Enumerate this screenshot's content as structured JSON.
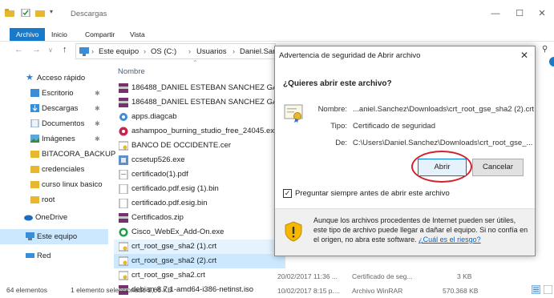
{
  "window": {
    "title": "Descargas",
    "controls": {
      "minimize": "—",
      "maximize": "☐",
      "close": "✕"
    }
  },
  "ribbon": {
    "tabs": [
      "Archivo",
      "Inicio",
      "Compartir",
      "Vista"
    ]
  },
  "address": {
    "crumbs": [
      "Este equipo",
      "OS (C:)",
      "Usuarios",
      "Daniel.Sanchez"
    ],
    "search_icon": "search-icon"
  },
  "sidebar": {
    "items": [
      {
        "label": "Acceso rápido",
        "icon": "star-icon",
        "pinned": false
      },
      {
        "label": "Escritorio",
        "icon": "desktop-icon",
        "pinned": true
      },
      {
        "label": "Descargas",
        "icon": "download-icon",
        "pinned": true
      },
      {
        "label": "Documentos",
        "icon": "document-icon",
        "pinned": true
      },
      {
        "label": "Imágenes",
        "icon": "image-icon",
        "pinned": true
      },
      {
        "label": "BITACORA_BACKUP",
        "icon": "folder-icon",
        "pinned": false
      },
      {
        "label": "credenciales",
        "icon": "folder-icon",
        "pinned": false
      },
      {
        "label": "curso linux basico",
        "icon": "folder-icon",
        "pinned": false
      },
      {
        "label": "root",
        "icon": "folder-icon",
        "pinned": false
      },
      {
        "label": "OneDrive",
        "icon": "cloud-icon",
        "pinned": false
      },
      {
        "label": "Este equipo",
        "icon": "computer-icon",
        "pinned": false
      },
      {
        "label": "Red",
        "icon": "network-icon",
        "pinned": false
      }
    ]
  },
  "list": {
    "column_name": "Nombre",
    "files": [
      {
        "name": "186488_DANIEL ESTEBAN SANCHEZ GA...",
        "icon": "archive-icon"
      },
      {
        "name": "186488_DANIEL ESTEBAN SANCHEZ GA...",
        "icon": "archive-icon"
      },
      {
        "name": "apps.diagcab",
        "icon": "diagcab-icon"
      },
      {
        "name": "ashampoo_burning_studio_free_24045.exe",
        "icon": "exe-icon"
      },
      {
        "name": "BANCO DE OCCIDENTE.cer",
        "icon": "certificate-icon"
      },
      {
        "name": "ccsetup526.exe",
        "icon": "exe-icon"
      },
      {
        "name": "certificado(1).pdf",
        "icon": "pdf-icon"
      },
      {
        "name": "certificado.pdf.esig (1).bin",
        "icon": "file-icon"
      },
      {
        "name": "certificado.pdf.esig.bin",
        "icon": "file-icon"
      },
      {
        "name": "Certificados.zip",
        "icon": "archive-icon"
      },
      {
        "name": "Cisco_WebEx_Add-On.exe",
        "icon": "webex-icon"
      },
      {
        "name": "crt_root_gse_sha2 (1).crt",
        "icon": "certificate-icon"
      },
      {
        "name": "crt_root_gse_sha2 (2).crt",
        "icon": "certificate-icon"
      },
      {
        "name": "crt_root_gse_sha2.crt",
        "icon": "certificate-icon"
      },
      {
        "name": "debian-8.7.1-amd64-i386-netinst.iso",
        "icon": "archive-icon"
      }
    ],
    "extra_rows": [
      {
        "date": "20/02/2017 11:36 ...",
        "type": "Certificado de seg...",
        "size": "3 KB"
      },
      {
        "date": "10/02/2017 8:15 p....",
        "type": "Archivo WinRAR",
        "size": "570.368 KB"
      }
    ]
  },
  "status": {
    "count": "64 elementos",
    "selection": "1 elemento seleccionado  2,06 KB"
  },
  "dialog": {
    "title": "Advertencia de seguridad de Abrir archivo",
    "question": "¿Quieres abrir este archivo?",
    "name_label": "Nombre:",
    "name_value": "...aniel.Sanchez\\Downloads\\crt_root_gse_sha2 (2).crt",
    "type_label": "Tipo:",
    "type_value": "Certificado de seguridad",
    "from_label": "De:",
    "from_value": "C:\\Users\\Daniel.Sanchez\\Downloads\\crt_root_gse_...",
    "open_label": "Abrir",
    "cancel_label": "Cancelar",
    "checkbox_label": "Preguntar siempre antes de abrir este archivo",
    "checkbox_checked": true,
    "warning_text": "Aunque los archivos procedentes de Internet pueden ser útiles, este tipo de archivo puede llegar a dañar el equipo. Si no confía en el origen, no abra este software.",
    "warning_link": "¿Cuál es el riesgo?",
    "close": "✕"
  },
  "colors": {
    "accent": "#1979ca",
    "selection": "#cce8ff",
    "highlight_circle": "#d3212d",
    "folder": "#e8b730"
  }
}
